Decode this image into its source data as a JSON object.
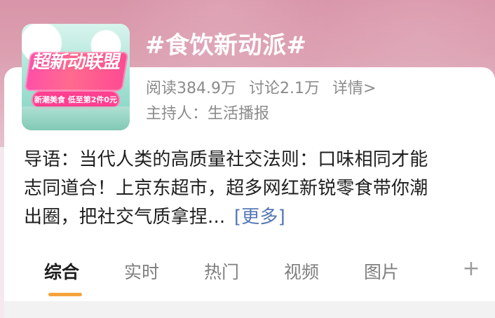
{
  "topic": {
    "thumbnail_title": "超新动联盟",
    "thumbnail_subtitle": "新潮美食 低至第2件0元",
    "title": "#食饮新动派#",
    "stats": {
      "read_label": "阅读384.9万",
      "discussion_label": "讨论2.1万",
      "details_label": "详情>"
    },
    "host_label": "主持人：生活播报"
  },
  "guide": {
    "line_1": "导语：当代人类的高质量社交法则：口味相同才能",
    "line_2": "志同道合！上京东超市，超多网红新锐零食带你潮",
    "line_3": "出圈，把社交气质拿捏...",
    "more_label": "[更多]"
  },
  "tabs": [
    {
      "label": "综合",
      "active": true
    },
    {
      "label": "实时",
      "active": false
    },
    {
      "label": "热门",
      "active": false
    },
    {
      "label": "视频",
      "active": false
    },
    {
      "label": "图片",
      "active": false
    }
  ],
  "icons": {
    "add_tab": "plus-icon"
  },
  "colors": {
    "hero_pink": "#d995a9",
    "link_blue": "#5577b5",
    "tab_indicator": "#f5a43b"
  }
}
